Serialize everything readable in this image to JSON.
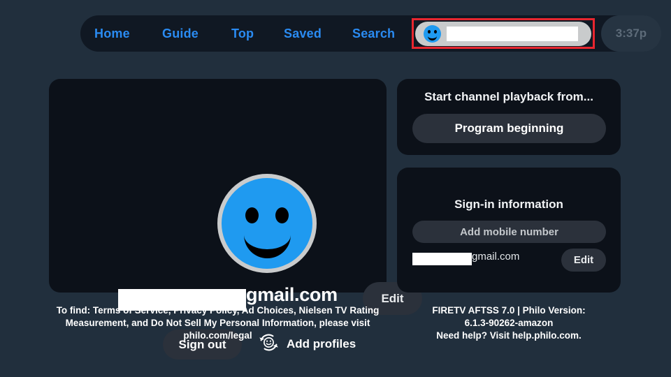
{
  "nav": {
    "items": [
      {
        "id": "home",
        "label": "Home"
      },
      {
        "id": "guide",
        "label": "Guide"
      },
      {
        "id": "top",
        "label": "Top"
      },
      {
        "id": "saved",
        "label": "Saved"
      },
      {
        "id": "search",
        "label": "Search"
      }
    ],
    "profile_pill": {
      "avatar_icon": "smiley-face-icon",
      "avatar_color": "#1f9af0",
      "pill_color": "#c9cbcc",
      "name_redacted": true
    },
    "highlight_color": "#e8262f",
    "clock": "3:37p",
    "accent_color": "#2a8bf2",
    "bar_color": "#101823"
  },
  "profile_card": {
    "avatar_icon": "smiley-face-icon",
    "avatar_color": "#1f9af0",
    "avatar_ring_color": "#c9cbcc",
    "email_suffix": "gmail.com",
    "email_redacted": true,
    "edit_label": "Edit",
    "sign_out_label": "Sign out",
    "add_profiles_label": "Add profiles",
    "add_profiles_icon": "switch-profile-smiley-icon"
  },
  "playback_card": {
    "title": "Start channel playback from...",
    "option_label": "Program beginning"
  },
  "signin_card": {
    "title": "Sign-in information",
    "add_mobile_label": "Add mobile number",
    "email_suffix": "gmail.com",
    "email_redacted": true,
    "edit_label": "Edit"
  },
  "footer": {
    "left_lines": [
      "To find: Terms of Service, Privacy Policy, Ad Choices, Nielsen TV Rating",
      "Measurement, and Do Not Sell My Personal Information, please visit",
      "philo.com/legal"
    ],
    "right_lines": [
      "FIRETV AFTSS 7.0 | Philo Version:",
      "6.1.3-90262-amazon",
      "Need help? Visit help.philo.com."
    ]
  },
  "theme": {
    "page_background": "#212f3d",
    "card_background": "#0c1119",
    "button_background": "#2b313b"
  }
}
